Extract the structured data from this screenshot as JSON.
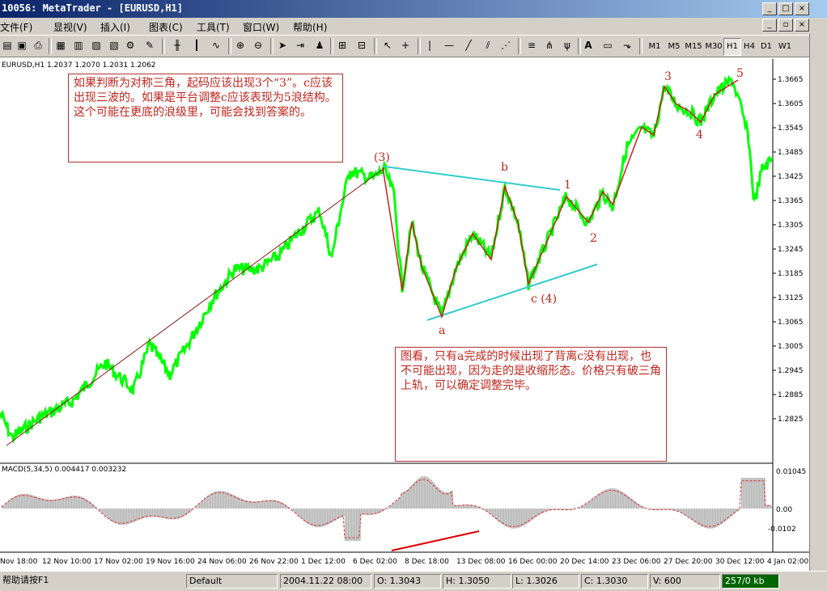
{
  "window": {
    "title": "10056: MetaTrader - [EURUSD,H1]"
  },
  "menu": [
    "文件(F)",
    "显视(V)",
    "插入(I)",
    "图表(C)",
    "工具(T)",
    "窗口(W)",
    "帮助(H)"
  ],
  "timeframes": [
    "M1",
    "M5",
    "M15",
    "M30",
    "H1",
    "H4",
    "D1",
    "W1"
  ],
  "active_timeframe": "H1",
  "chart": {
    "header": "EURUSD,H1  1.2037 1.2070 1.2031 1.2062",
    "note1": "如果判断为对称三角，起码应该出现3个“3”。c应该出现三波的。如果是平台调整c应该表现为5浪结构。这个可能在更底的浪级里，可能会找到答案的。",
    "note2": "图看，只有a完成的时候出现了背离c没有出现，也不可能出现，因为走的是收缩形态。价格只有破三角上轨，可以确定调整完毕。",
    "wave_labels": {
      "w3": "(3)",
      "b": "b",
      "w1": "1",
      "w2": "2",
      "a": "a",
      "c4": "c (4)",
      "top3": "3",
      "top4": "4",
      "top5": "5"
    },
    "price_ticks": [
      "1.3665",
      "1.3605",
      "1.3545",
      "1.3485",
      "1.3425",
      "1.3365",
      "1.3305",
      "1.3245",
      "1.3185",
      "1.3125",
      "1.3065",
      "1.3005",
      "1.2945",
      "1.2885",
      "1.2825"
    ],
    "time_ticks": [
      "Nov 18:00",
      "12 Nov 10:00",
      "17 Nov 02:00",
      "19 Nov 16:00",
      "24 Nov 06:00",
      "26 Nov 22:00",
      "1 Dec 12:00",
      "6 Dec 02:00",
      "8 Dec 18:00",
      "13 Dec 08:00",
      "16 Dec 00:00",
      "20 Dec 14:00",
      "23 Dec 06:00",
      "27 Dec 20:00",
      "30 Dec 12:00",
      "4 Jan 02:00"
    ],
    "indicator_header": "MACD(5,34,5)  0.004417  0.003232",
    "indicator_ticks": [
      "0.01045",
      "0.00",
      "-0.0102"
    ],
    "colors": {
      "price": "#00ff00",
      "wave": "#c0241c",
      "channel": "#33cccc",
      "macd_hist": "#b4b4b4",
      "macd_signal": "#e03030"
    }
  },
  "status": {
    "help": "帮助请按F1",
    "profile": "Default",
    "time": "2004.11.22 08:00",
    "open": "O: 1.3043",
    "high": "H: 1.3050",
    "low": "L: 1.3026",
    "close": "C: 1.3030",
    "volume": "V: 600",
    "traffic": "257/0 kb"
  }
}
